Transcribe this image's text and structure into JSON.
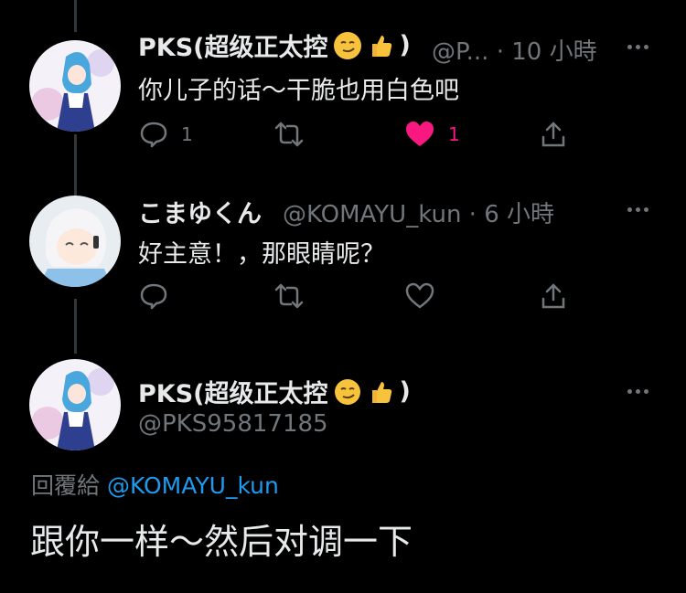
{
  "tweets": [
    {
      "name": "PKS(超级正太控",
      "name_suffix": ")",
      "handle_time": "@P... · 10 小時",
      "text": "你儿子的话～干脆也用白色吧",
      "reply_count": "1",
      "like_count": "1",
      "liked": true
    },
    {
      "name": "こまゆくん",
      "handle_time": "@KOMAYU_kun · 6 小時",
      "text": "好主意！，那眼睛呢？"
    }
  ],
  "main_tweet": {
    "name": "PKS(超级正太控",
    "name_suffix": ")",
    "handle": "@PKS95817185",
    "reply_prefix": "回覆給",
    "reply_mention": "@KOMAYU_kun",
    "text": "跟你一样～然后对调一下"
  },
  "colors": {
    "background": "#000000",
    "text": "#e7e9ea",
    "muted": "#71767b",
    "accent": "#1d9bf0",
    "like": "#f91880"
  },
  "icons": [
    "reply-icon",
    "retweet-icon",
    "like-icon",
    "share-icon",
    "more-icon",
    "smirk-emoji-icon",
    "thumbs-up-emoji-icon"
  ]
}
